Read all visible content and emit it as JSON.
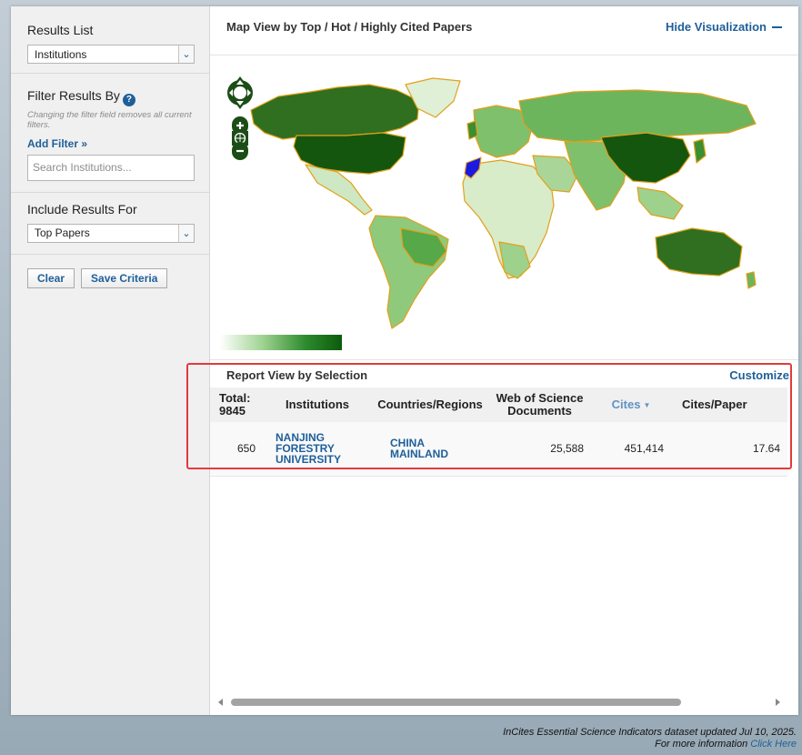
{
  "sidebar": {
    "results_list": {
      "title": "Results List",
      "selected": "Institutions"
    },
    "filter": {
      "title": "Filter Results By",
      "note": "Changing the filter field removes all current filters.",
      "add_filter": "Add Filter »",
      "search_placeholder": "Search Institutions..."
    },
    "include": {
      "title": "Include Results For",
      "selected": "Top Papers"
    },
    "buttons": {
      "clear": "Clear",
      "save": "Save Criteria"
    }
  },
  "map": {
    "title": "Map View by Top / Hot / Highly Cited Papers",
    "hide_label": "Hide Visualization",
    "colors": {
      "low": "#ffffff",
      "mid": "#9fd391",
      "high": "#0b5c0b",
      "border": "#e2a01a",
      "selected": "#1a1ae0"
    }
  },
  "report": {
    "title": "Report View by Selection",
    "customize": "Customize",
    "total_label": "Total:",
    "total_value": "9845",
    "columns": {
      "institutions": "Institutions",
      "countries": "Countries/Regions",
      "wos_line1": "Web of Science",
      "wos_line2": "Documents",
      "cites": "Cites",
      "cites_per_paper": "Cites/Paper"
    },
    "rows": [
      {
        "rank": "650",
        "inst_l1": "NANJING",
        "inst_l2": "FORESTRY",
        "inst_l3": "UNIVERSITY",
        "country_l1": "CHINA",
        "country_l2": "MAINLAND",
        "wos": "25,588",
        "cites": "451,414",
        "cpp": "17.64"
      }
    ]
  },
  "footer": {
    "line1": "InCites Essential Science Indicators dataset updated Jul 10, 2025.",
    "line2_prefix": "For more information ",
    "line2_link": "Click Here"
  }
}
